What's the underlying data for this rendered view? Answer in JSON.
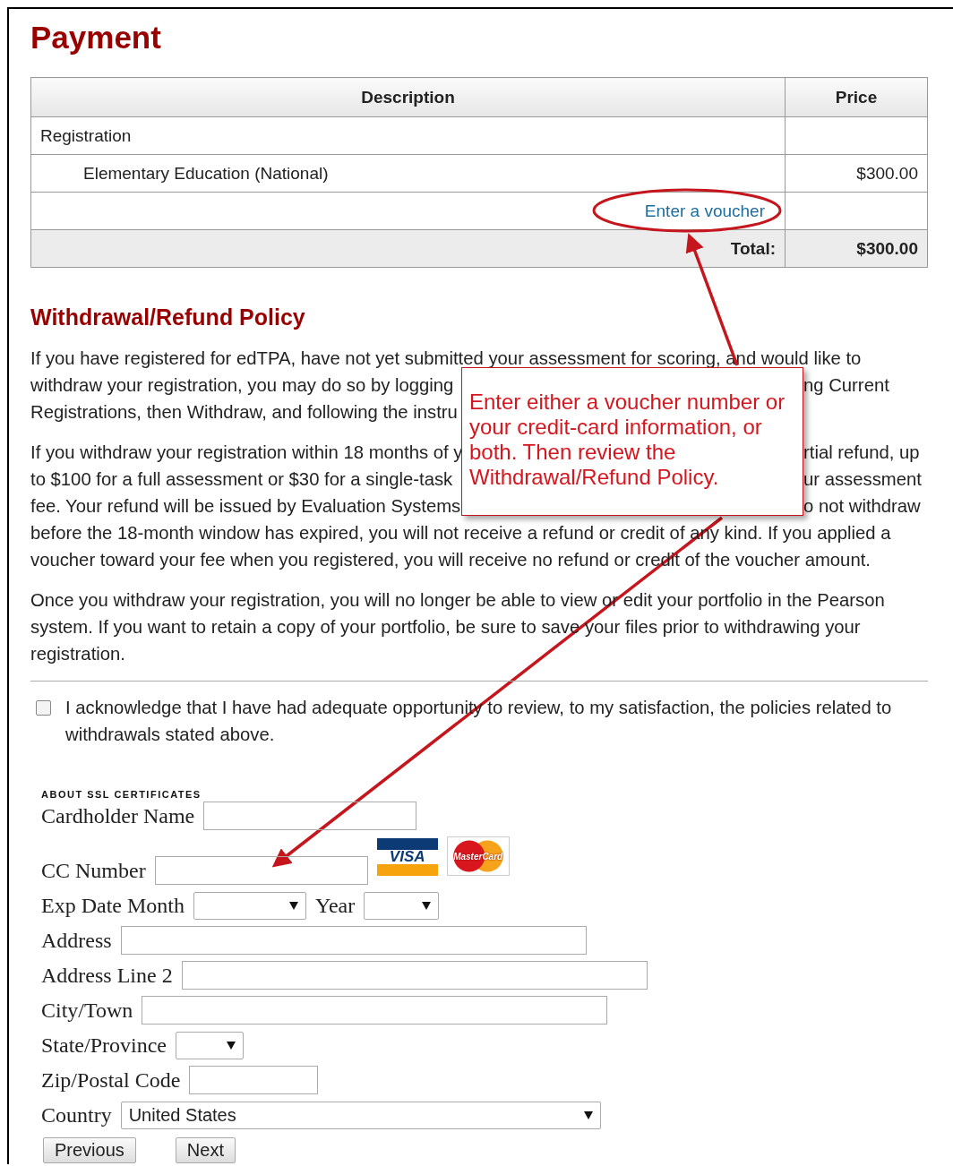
{
  "page_title": "Payment",
  "table": {
    "columns": [
      "Description",
      "Price"
    ],
    "rows": [
      {
        "kind": "group",
        "description": "Registration"
      },
      {
        "kind": "item",
        "description": "Elementary Education (National)",
        "price": "$300.00"
      },
      {
        "kind": "voucher",
        "link": "Enter a voucher"
      },
      {
        "kind": "total",
        "description": "Total:",
        "price": "$300.00"
      }
    ]
  },
  "policy": {
    "title": "Withdrawal/Refund Policy",
    "paragraphs": [
      {
        "kind": "lines",
        "lines": [
          {
            "left": "If you have registered for edTPA, have not yet submitted your assessment for scoring, and would like to"
          },
          {
            "left": "withdraw your registration, you may do so by logging",
            "right": "ng Current"
          },
          {
            "left": "Registrations, then Withdraw, and following the instru"
          }
        ]
      },
      {
        "kind": "lines",
        "lines": [
          {
            "left": "If you withdraw your registration within 18 months of y",
            "right": "rtial refund, up"
          },
          {
            "left": "to $100 for a full assessment or $30 for a single-task",
            "right": "ur assessment"
          },
          {
            "left": "fee. Your refund will be issued by Evaluation Systems",
            "right": "o not withdraw"
          },
          {
            "left": "before the 18-month window has expired, you will not receive a refund or credit of any kind. If you applied a"
          },
          {
            "left": "voucher toward your fee when you registered, you will receive no refund or credit of the voucher amount."
          }
        ]
      },
      {
        "kind": "text",
        "text": "Once you withdraw your registration, you will no longer be able to view or edit your portfolio in the Pearson system. If you want to retain a copy of your portfolio, be sure to save your files prior to withdrawing your registration."
      }
    ]
  },
  "acknowledge": {
    "checked": false,
    "text": "I acknowledge that I have had adequate opportunity to review, to my satisfaction, the policies related to withdrawals stated above."
  },
  "ssl_link": "ABOUT SSL CERTIFICATES",
  "form": {
    "fields": [
      {
        "kind": "text",
        "label": "Cardholder Name"
      },
      {
        "kind": "card",
        "label": "CC Number",
        "logos": [
          "VISA",
          "MasterCard"
        ]
      },
      {
        "kind": "date",
        "label": "Exp Date Month",
        "label2": "Year"
      },
      {
        "kind": "text",
        "label": "Address"
      },
      {
        "kind": "text",
        "label": "Address Line 2"
      },
      {
        "kind": "text",
        "label": "City/Town"
      },
      {
        "kind": "select",
        "label": "State/Province"
      },
      {
        "kind": "text",
        "label": "Zip/Postal Code"
      },
      {
        "kind": "select",
        "label": "Country",
        "value": "United States"
      }
    ]
  },
  "buttons": [
    "Previous",
    "Next"
  ],
  "callout": {
    "text": "Enter either a voucher number or your credit-card information, or both. Then review the Withdrawal/Refund Policy."
  }
}
